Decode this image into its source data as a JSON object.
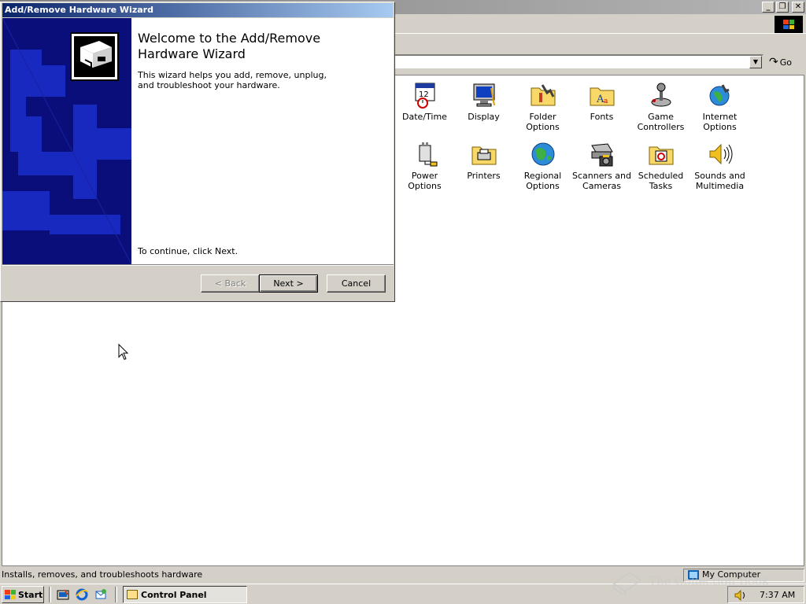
{
  "control_panel": {
    "address_go_label": "Go",
    "icons_row1": [
      {
        "label": "Date/Time",
        "icon": "date-time-icon"
      },
      {
        "label": "Display",
        "icon": "display-icon"
      },
      {
        "label": "Folder Options",
        "icon": "folder-options-icon"
      },
      {
        "label": "Fonts",
        "icon": "fonts-icon"
      },
      {
        "label": "Game Controllers",
        "icon": "game-controllers-icon"
      },
      {
        "label": "Internet Options",
        "icon": "internet-options-icon"
      }
    ],
    "icons_row2": [
      {
        "label": "Power Options",
        "icon": "power-options-icon"
      },
      {
        "label": "Printers",
        "icon": "printers-icon"
      },
      {
        "label": "Regional Options",
        "icon": "regional-options-icon"
      },
      {
        "label": "Scanners and Cameras",
        "icon": "scanners-cameras-icon"
      },
      {
        "label": "Scheduled Tasks",
        "icon": "scheduled-tasks-icon"
      },
      {
        "label": "Sounds and Multimedia",
        "icon": "sounds-multimedia-icon"
      }
    ],
    "status_text": "Installs, removes, and troubleshoots hardware",
    "status_zone": "My Computer"
  },
  "wizard": {
    "title": "Add/Remove Hardware Wizard",
    "heading": "Welcome to the Add/Remove Hardware Wizard",
    "description": "This wizard helps you add, remove, unplug, and troubleshoot your hardware.",
    "continue_text": "To continue, click Next.",
    "back_label": "< Back",
    "next_label": "Next >",
    "cancel_label": "Cancel",
    "title_color": "#0a246a",
    "side_color": "#0a0e7a"
  },
  "taskbar": {
    "start_label": "Start",
    "task_label": "Control Panel",
    "clock": "7:37 AM"
  },
  "watermark": "The Collection Book"
}
